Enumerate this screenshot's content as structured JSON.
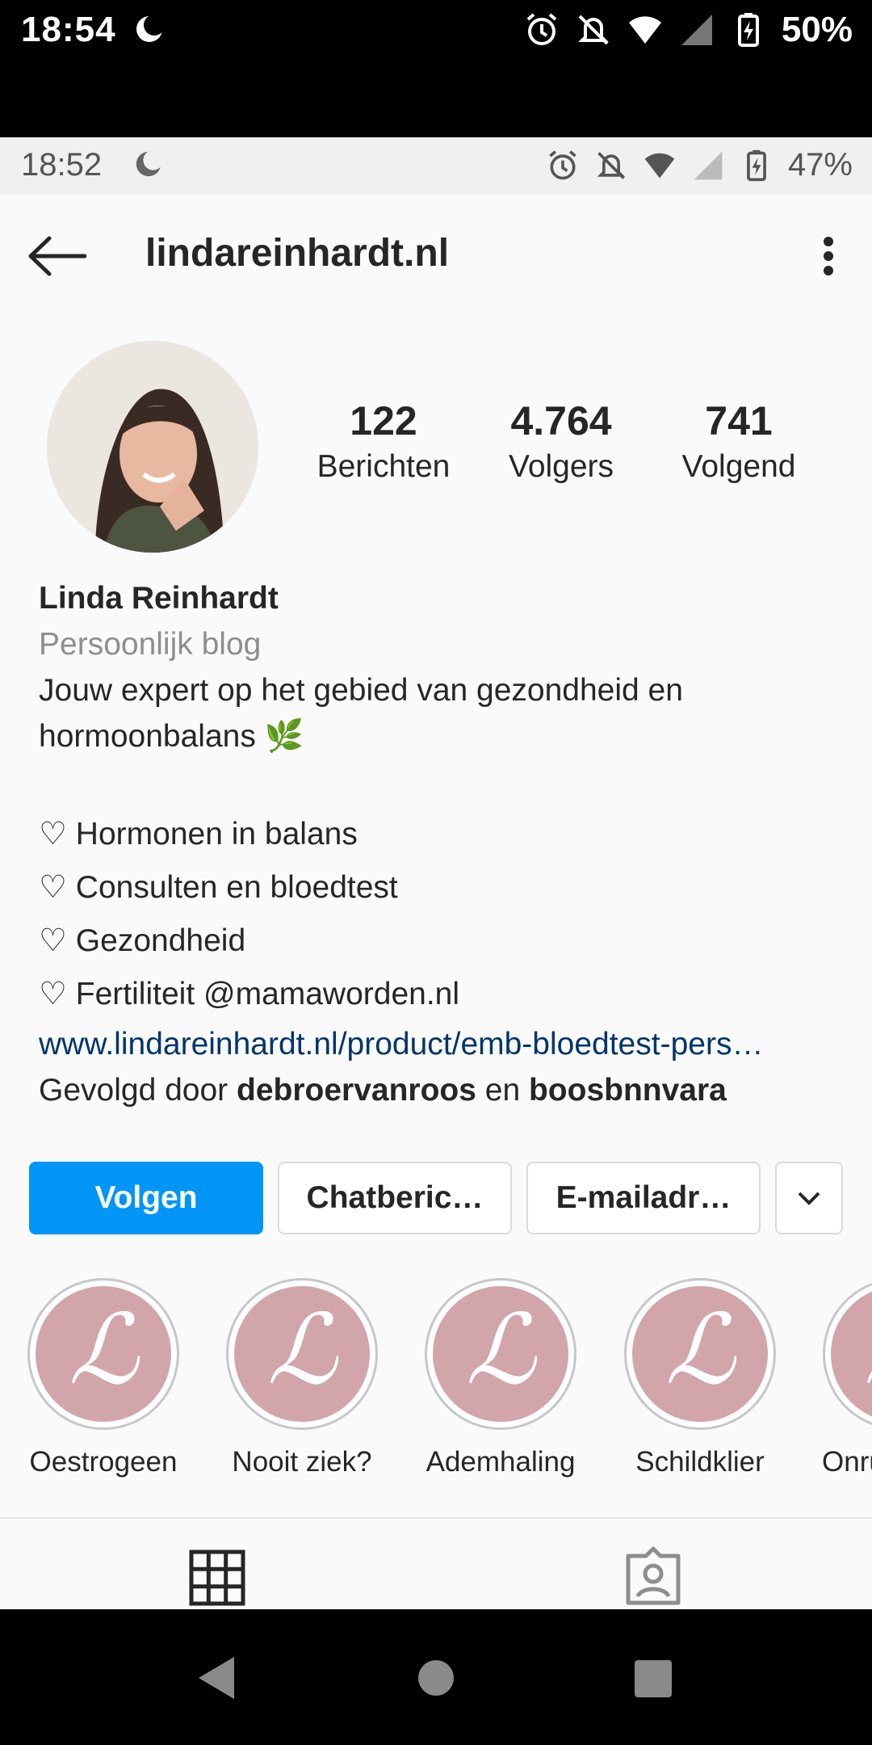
{
  "outer_status": {
    "time": "18:54",
    "battery": "50%"
  },
  "inner_status": {
    "time": "18:52",
    "battery": "47%"
  },
  "header": {
    "username": "lindareinhardt.nl"
  },
  "stats": [
    {
      "value": "122",
      "label": "Berichten"
    },
    {
      "value": "4.764",
      "label": "Volgers"
    },
    {
      "value": "741",
      "label": "Volgend"
    }
  ],
  "bio": {
    "name": "Linda Reinhardt",
    "category": "Persoonlijk blog",
    "line1": "Jouw expert op het gebied van gezondheid en",
    "line2": "hormoonbalans 🌿",
    "items": [
      "♡ Hormonen in balans",
      "♡ Consulten en bloedtest",
      "♡ Gezondheid",
      "♡ Fertiliteit @mamaworden.nl"
    ],
    "link": "www.lindareinhardt.nl/product/emb-bloedtest-pers…",
    "followed_prefix": "Gevolgd door ",
    "followed_user1": "debroervanroos",
    "followed_mid": " en ",
    "followed_user2": "boosbnnvara"
  },
  "actions": {
    "follow": "Volgen",
    "message": "Chatberic…",
    "email": "E-mailadr…"
  },
  "highlights": [
    {
      "label": "Oestrogeen"
    },
    {
      "label": "Nooit ziek?"
    },
    {
      "label": "Ademhaling"
    },
    {
      "label": "Schildklier"
    },
    {
      "label": "Onrus"
    }
  ],
  "colors": {
    "primary": "#0095f6",
    "highlight_bg": "#d1a5aa",
    "link": "#003569"
  }
}
